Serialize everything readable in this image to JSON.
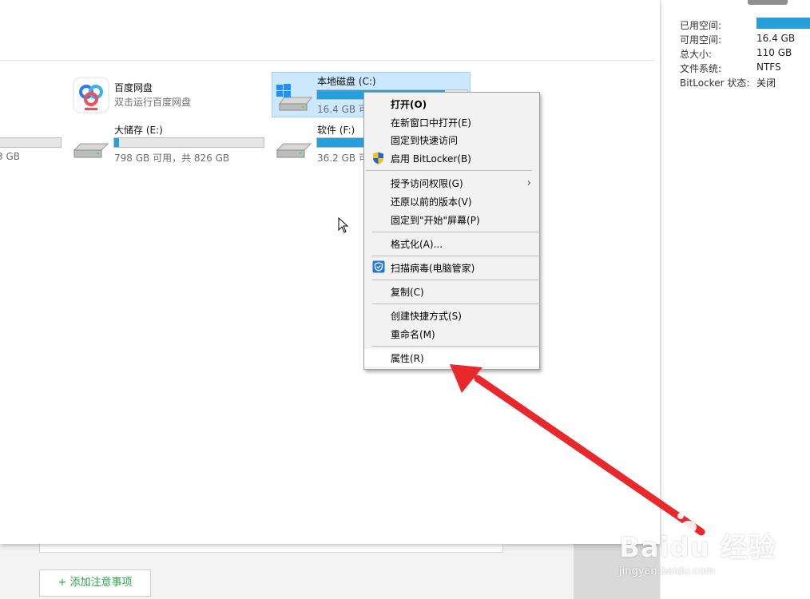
{
  "details": {
    "rows": [
      {
        "label": "已用空间:",
        "value": ""
      },
      {
        "label": "可用空间:",
        "value": "16.4 GB"
      },
      {
        "label": "总大小:",
        "value": "110 GB"
      },
      {
        "label": "文件系统:",
        "value": "NTFS"
      },
      {
        "label": "BitLocker 状态:",
        "value": "关闭"
      }
    ],
    "used_fraction": 0.85
  },
  "drives": {
    "partial_left": {
      "sub": "3 GB",
      "used_fraction": 0.0
    },
    "baidu": {
      "name": "百度网盘",
      "sub": "双击运行百度网盘"
    },
    "c": {
      "name": "本地磁盘 (C:)",
      "sub": "16.4 GB 可",
      "used_fraction": 0.85
    },
    "e": {
      "name": "大储存 (E:)",
      "sub": "798 GB 可用，共 826 GB",
      "used_fraction": 0.03
    },
    "f": {
      "name": "软件 (F:)",
      "sub": "36.2 GB 可",
      "used_fraction": 0.2
    }
  },
  "context_menu": {
    "items": [
      {
        "label": "打开(O)",
        "bold": true
      },
      {
        "label": "在新窗口中打开(E)"
      },
      {
        "label": "固定到快速访问"
      },
      {
        "label": "启用 BitLocker(B)",
        "icon": "uac-shield-icon"
      },
      {
        "label": "授予访问权限(G)",
        "submenu": true
      },
      {
        "label": "还原以前的版本(V)"
      },
      {
        "label": "固定到\"开始\"屏幕(P)"
      },
      {
        "label": "格式化(A)..."
      },
      {
        "label": "扫描病毒(电脑管家)",
        "icon": "tencent-pc-manager-icon"
      },
      {
        "label": "复制(C)"
      },
      {
        "label": "创建快捷方式(S)"
      },
      {
        "label": "重命名(M)"
      },
      {
        "label": "属性(R)",
        "highlighted": true
      }
    ],
    "submenu_glyph": "›"
  },
  "notes": {
    "add_button": "+ 添加注意事项"
  },
  "watermark": {
    "title": "Baidu 经验",
    "url": "jingyan.baidu.com"
  },
  "colors": {
    "accent_bar": "#26a0da",
    "selection": "#cce8ff",
    "arrow": "#e8282b",
    "add_button_text": "#2aa347"
  }
}
